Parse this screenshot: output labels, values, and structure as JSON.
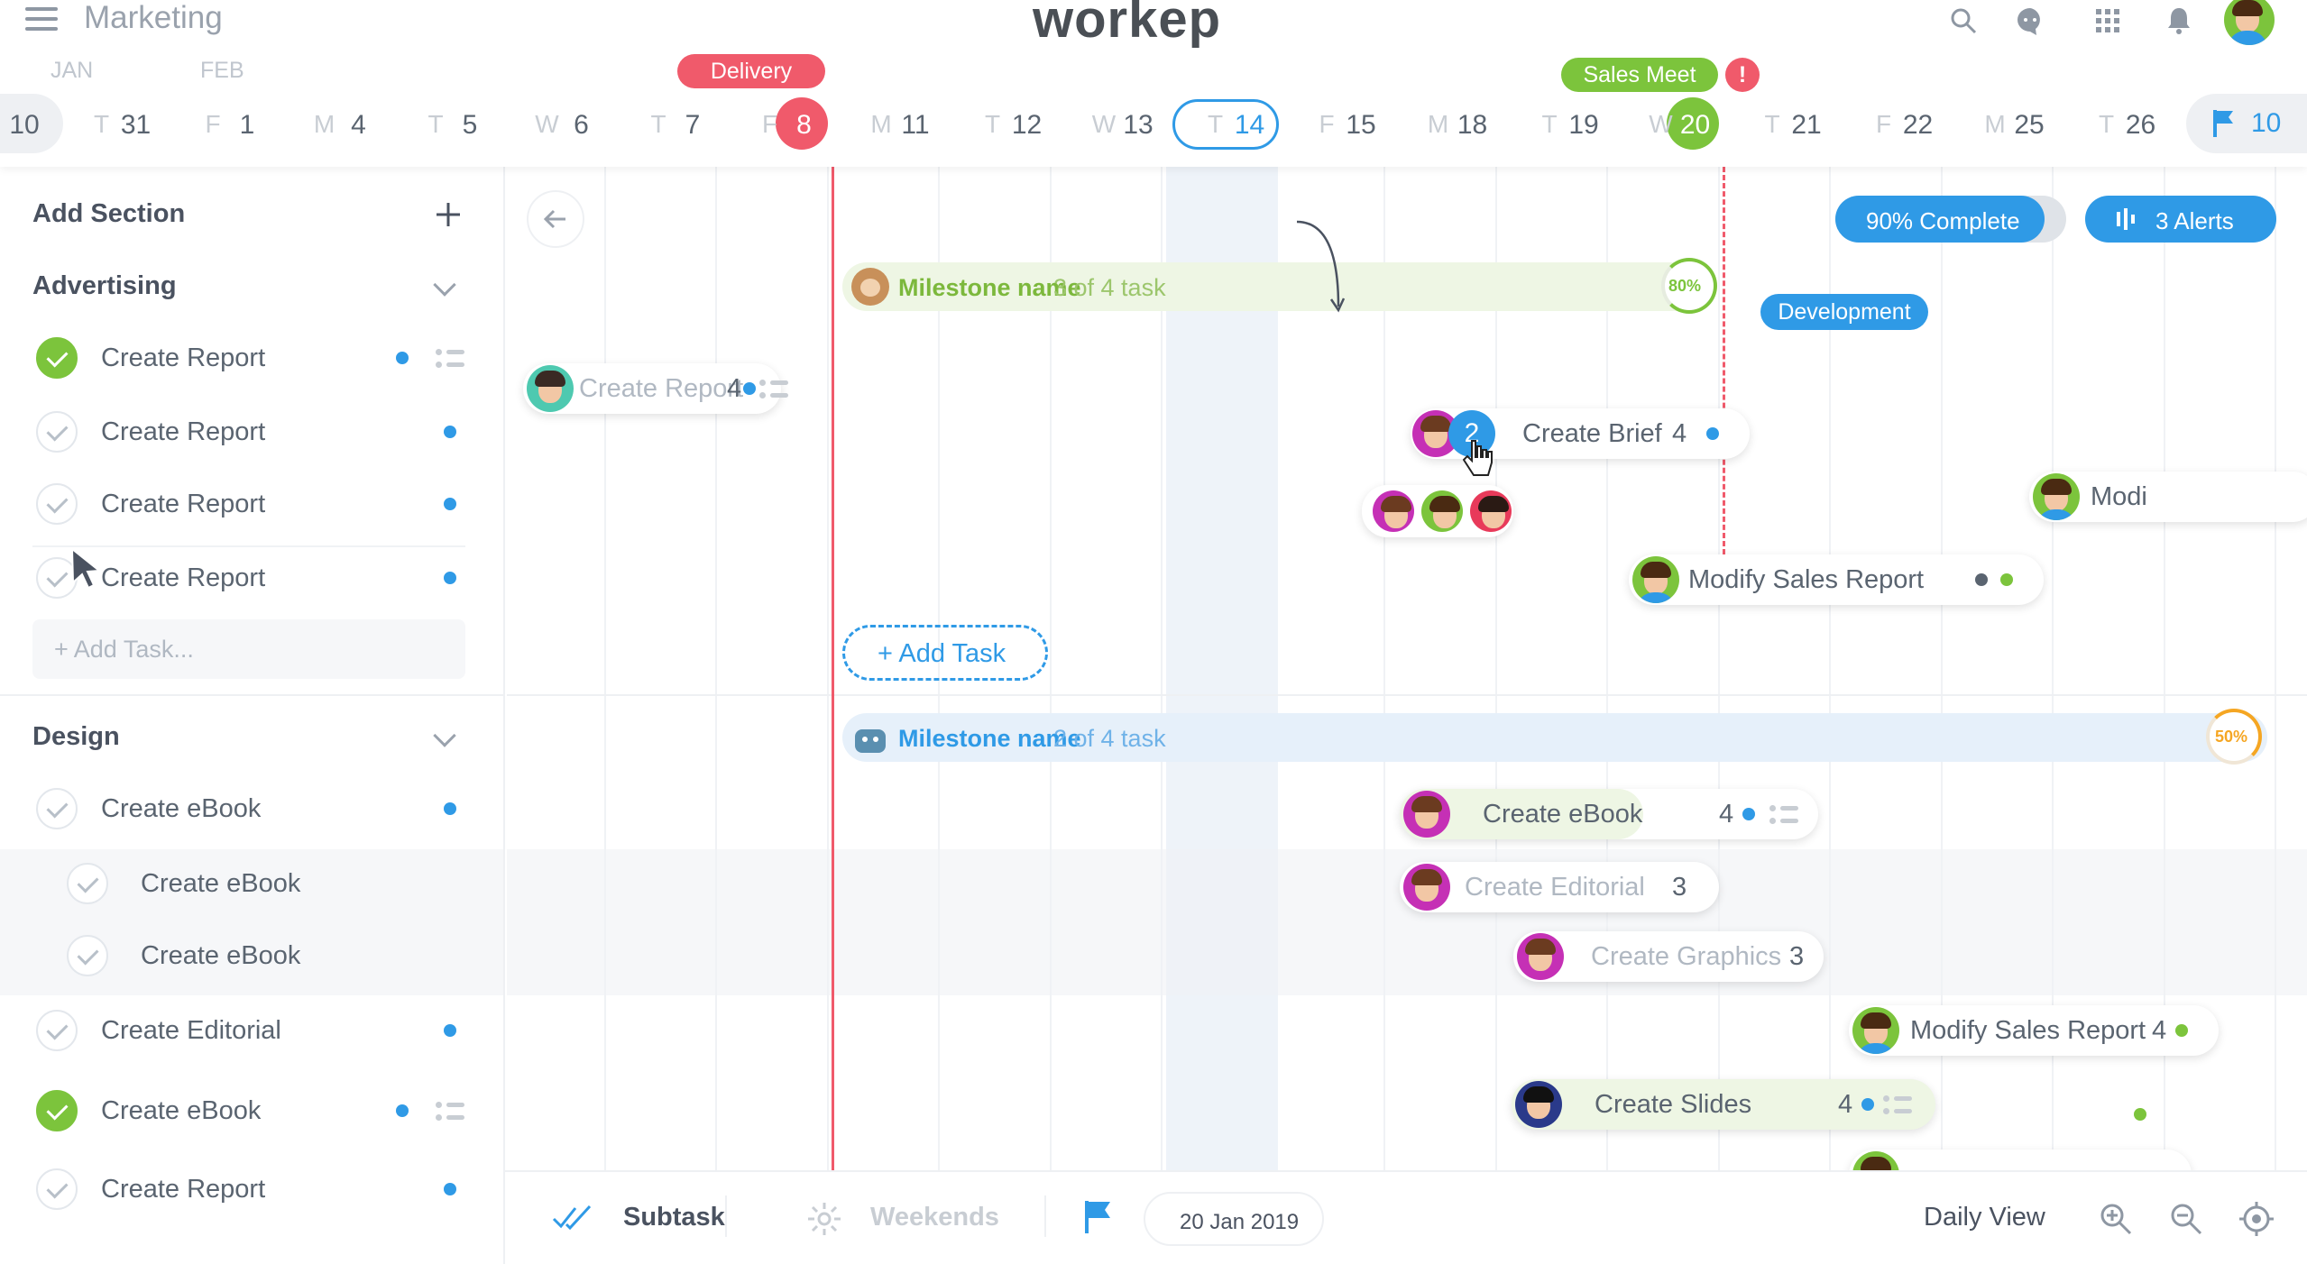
{
  "header": {
    "project": "Marketing",
    "logo": "workep",
    "icons": [
      "menu-icon",
      "search-icon",
      "chat-icon",
      "apps-grid-icon",
      "bell-icon",
      "user-avatar"
    ]
  },
  "timeline": {
    "months": [
      "JAN",
      "FEB"
    ],
    "days": [
      {
        "w": "",
        "d": "10"
      },
      {
        "w": "T",
        "d": "31"
      },
      {
        "w": "F",
        "d": "1"
      },
      {
        "w": "M",
        "d": "4"
      },
      {
        "w": "T",
        "d": "5"
      },
      {
        "w": "W",
        "d": "6"
      },
      {
        "w": "T",
        "d": "7"
      },
      {
        "w": "F",
        "d": "8"
      },
      {
        "w": "M",
        "d": "11"
      },
      {
        "w": "T",
        "d": "12"
      },
      {
        "w": "W",
        "d": "13"
      },
      {
        "w": "T",
        "d": "14"
      },
      {
        "w": "F",
        "d": "15"
      },
      {
        "w": "M",
        "d": "18"
      },
      {
        "w": "T",
        "d": "19"
      },
      {
        "w": "W",
        "d": "20"
      },
      {
        "w": "T",
        "d": "21"
      },
      {
        "w": "F",
        "d": "22"
      },
      {
        "w": "M",
        "d": "25"
      },
      {
        "w": "T",
        "d": "26"
      }
    ],
    "flag_count": "10",
    "events": [
      {
        "label": "Delivery",
        "color": "#f05a6b"
      },
      {
        "label": "Sales Meet",
        "color": "#7cc43c"
      }
    ],
    "alert_mark": "!"
  },
  "sidebar": {
    "add_section": "Add Section",
    "sections": [
      {
        "name": "Advertising",
        "tasks": [
          "Create Report",
          "Create Report",
          "Create Report",
          "Create Report"
        ],
        "add_task": "+ Add Task..."
      },
      {
        "name": "Design",
        "tasks": [
          "Create eBook",
          "Create eBook",
          "Create eBook",
          "Create Editorial",
          "Create eBook",
          "Create Report"
        ]
      }
    ]
  },
  "gantt": {
    "complete_label": "90% Complete",
    "alerts_label": "3 Alerts",
    "milestone1": {
      "name": "Milestone name",
      "count": "3 of 4 task",
      "pct": "80%"
    },
    "milestone2": {
      "name": "Milestone name",
      "count": "2 of 4 task",
      "pct": "50%"
    },
    "tasks": [
      {
        "label": "Create Report",
        "num": "4"
      },
      {
        "label": "Create Brief",
        "num": "4",
        "badge": "2"
      },
      {
        "label": "Modify Sales Report"
      },
      {
        "label": "Modi"
      },
      {
        "label": "Create eBook",
        "num": "4"
      },
      {
        "label": "Create Editorial",
        "num": "3"
      },
      {
        "label": "Create Graphics",
        "num": "3"
      },
      {
        "label": "Modify Sales Report",
        "num": "4"
      },
      {
        "label": "Create Slides",
        "num": "4"
      }
    ],
    "development_tag": "Development",
    "add_task": "+ Add Task"
  },
  "footer": {
    "subtask": "Subtask",
    "weekends": "Weekends",
    "date": "20 Jan 2019",
    "view": "Daily View"
  }
}
